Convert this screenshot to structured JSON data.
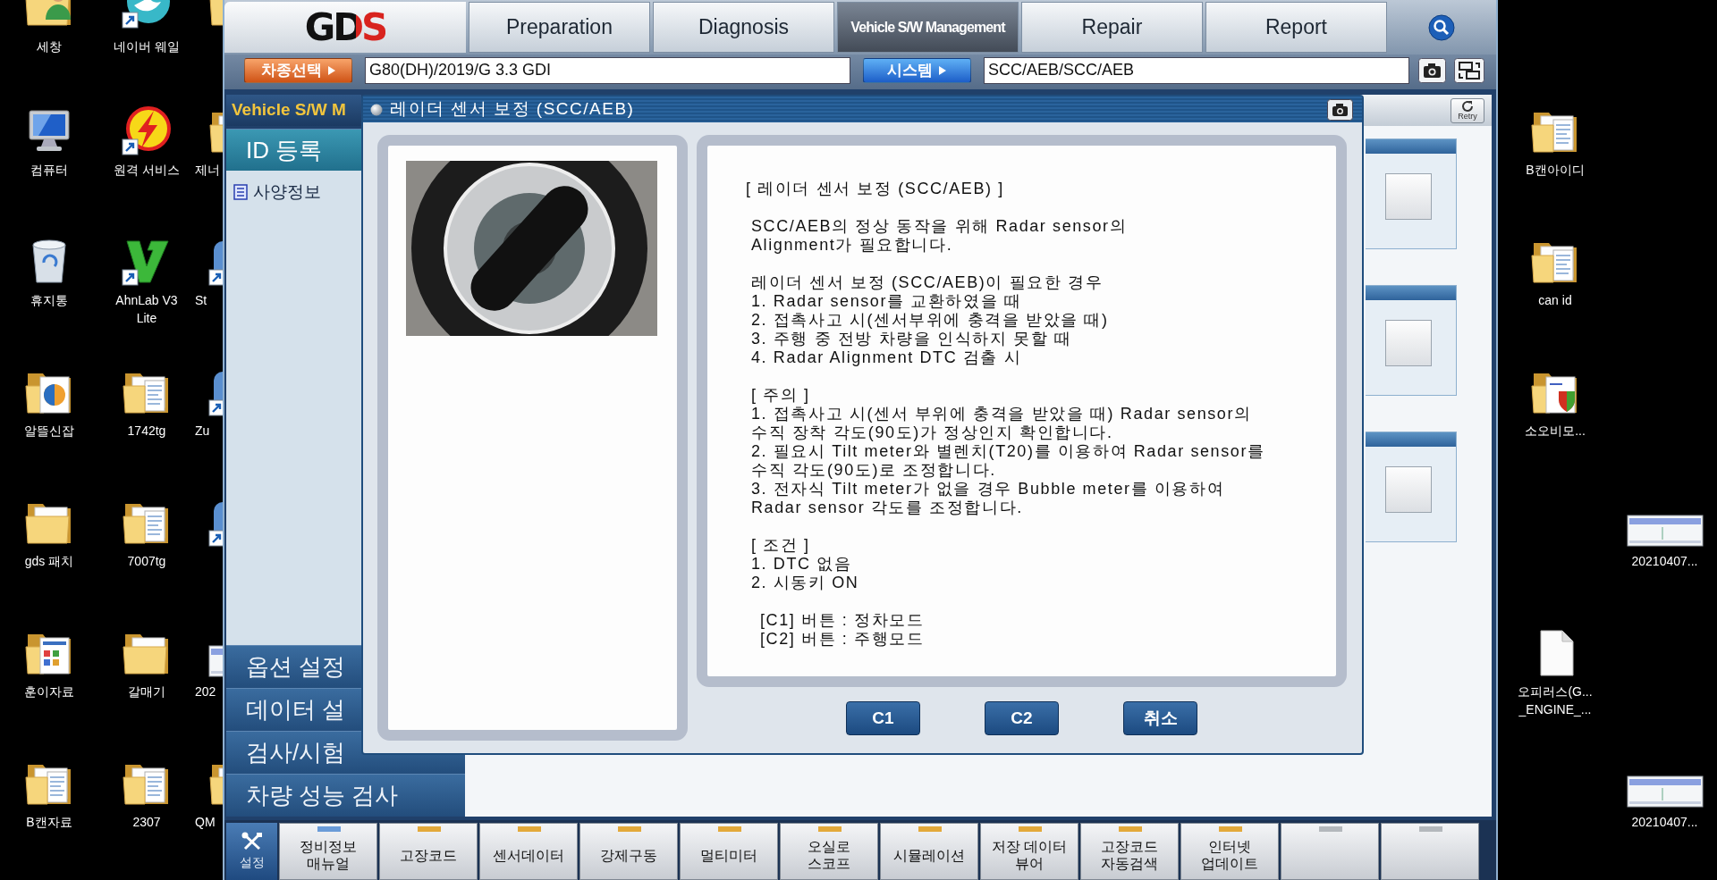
{
  "desktop_left": {
    "columns": [
      [
        {
          "kind": "userfolder",
          "label": "세창",
          "shortcut": false
        },
        {
          "kind": "computer",
          "label": "컴퓨터",
          "shortcut": false
        },
        {
          "kind": "trash",
          "label": "휴지통",
          "shortcut": false
        },
        {
          "kind": "mediafolder",
          "label": "알뜰신잡",
          "shortcut": false
        },
        {
          "kind": "folder",
          "label": "gds 패치",
          "shortcut": false
        },
        {
          "kind": "chartfolder",
          "label": "훈이자료",
          "shortcut": false
        },
        {
          "kind": "docfolder",
          "label": "B캔자료",
          "shortcut": false
        }
      ],
      [
        {
          "kind": "whale",
          "label": "네이버 웨일",
          "shortcut": true
        },
        {
          "kind": "bolt",
          "label": "원격 서비스",
          "shortcut": true
        },
        {
          "kind": "vmark",
          "label": "AhnLab V3\nLite",
          "shortcut": true
        },
        {
          "kind": "docfolder",
          "label": "1742tg",
          "shortcut": false
        },
        {
          "kind": "docfolder",
          "label": "7007tg",
          "shortcut": false
        },
        {
          "kind": "folder",
          "label": "갈매기",
          "shortcut": false
        },
        {
          "kind": "docfolder",
          "label": "2307",
          "shortcut": false
        }
      ],
      [
        {
          "kind": "folder",
          "shortcut": false
        },
        {
          "kind": "folder",
          "label": "제너",
          "shortcut": false
        },
        {
          "kind": "app",
          "label": "St",
          "shortcut": true
        },
        {
          "kind": "app",
          "label": "Zu",
          "shortcut": true
        },
        {
          "kind": "app",
          "shortcut": true
        },
        {
          "kind": "image",
          "label": "202",
          "shortcut": false
        },
        {
          "kind": "folder",
          "label": "QM",
          "shortcut": false
        }
      ]
    ]
  },
  "app": {
    "logo": "GDS",
    "tabs": [
      {
        "label": "Preparation",
        "selected": false
      },
      {
        "label": "Diagnosis",
        "selected": false
      },
      {
        "label": "Vehicle S/W Management",
        "selected": true
      },
      {
        "label": "Repair",
        "selected": false
      },
      {
        "label": "Report",
        "selected": false
      }
    ],
    "vehicle_bar": {
      "vehicle_button": "차종선택",
      "vehicle": "G80(DH)/2019/G 3.3 GDI",
      "system_button": "시스템",
      "system": "SCC/AEB/SCC/AEB"
    },
    "sidebar": {
      "title": "Vehicle S/W M",
      "sections": [
        {
          "label": "ID 등록",
          "selected": true,
          "entries": [
            "사양정보"
          ]
        },
        {
          "label": "옵션 설정",
          "selected": false
        },
        {
          "label": "데이터 설",
          "selected": false
        },
        {
          "label": "검사/시험",
          "selected": false
        },
        {
          "label": "차량 성능 검사",
          "selected": false
        }
      ]
    },
    "retry_button": "Retry",
    "toolbar": {
      "settings": "설정",
      "buttons": [
        {
          "label": "정비정보\n매뉴얼",
          "color": "#6a9bd8"
        },
        {
          "label": "고장코드",
          "color": "#e3a93a"
        },
        {
          "label": "센서데이터",
          "color": "#e3a93a"
        },
        {
          "label": "강제구동",
          "color": "#e3a93a"
        },
        {
          "label": "멀티미터",
          "color": "#e3a93a"
        },
        {
          "label": "오실로\n스코프",
          "color": "#e3a93a"
        },
        {
          "label": "시뮬레이션",
          "color": "#e3a93a"
        },
        {
          "label": "저장 데이터\n뷰어",
          "color": "#e3a93a"
        },
        {
          "label": "고장코드\n자동검색",
          "color": "#e3a93a"
        },
        {
          "label": "인터넷\n업데이트",
          "color": "#e3a93a"
        },
        {
          "color": "#b4b8bc"
        },
        {
          "color": "#b4b8bc"
        }
      ]
    }
  },
  "dialog": {
    "title": "레이더 센서 보정 (SCC/AEB)",
    "groups": [
      {
        "kind": "heading",
        "lines": [
          "[ 레이더 센서 보정 (SCC/AEB) ]"
        ]
      },
      {
        "kind": "body",
        "lines": [
          "SCC/AEB의 정상 동작을 위해 Radar sensor의\nAlignment가 필요합니다."
        ]
      },
      {
        "kind": "body",
        "lines": [
          "레이더 센서 보정 (SCC/AEB)이 필요한 경우",
          "1. Radar sensor를 교환하였을 때",
          "2. 접촉사고 시(센서부위에 충격을 받았을 때)",
          "3. 주행 중 전방 차량을 인식하지 못할 때",
          "4. Radar Alignment DTC 검출 시"
        ]
      },
      {
        "kind": "body",
        "lines": [
          "[ 주의 ]",
          "1. 접촉사고 시(센서 부위에 충격을 받았을 때) Radar sensor의\n수직 장착 각도(90도)가 정상인지 확인합니다.",
          "2. 필요시 Tilt meter와 별렌치(T20)를 이용하여 Radar sensor를\n수직 각도(90도)로 조정합니다.",
          "3. 전자식 Tilt meter가 없을 경우 Bubble meter를 이용하여\nRadar sensor 각도를 조정합니다."
        ]
      },
      {
        "kind": "body",
        "lines": [
          "[ 조건 ]",
          "1. DTC 없음",
          "2. 시동키 ON"
        ]
      },
      {
        "kind": "legend",
        "lines": [
          "[C1] 버튼 : 정차모드",
          "[C2] 버튼 : 주행모드"
        ]
      }
    ],
    "buttons": [
      "C1",
      "C2",
      "취소"
    ]
  },
  "desktop_right": {
    "icons": [
      {
        "kind": "docfolder",
        "label": "B캔아이디",
        "shortcut": false
      },
      {
        "kind": "docfolder",
        "label": "can id",
        "shortcut": false
      },
      {
        "kind": "shieldfolder",
        "label": "소오비모...",
        "shortcut": false
      },
      {
        "kind": "image",
        "label": "20210407...",
        "shortcut": false
      },
      {
        "kind": "file",
        "label": "오피러스(G...\n_ENGINE_...",
        "shortcut": false
      },
      {
        "kind": "image",
        "label": "20210407...",
        "shortcut": false
      }
    ]
  }
}
